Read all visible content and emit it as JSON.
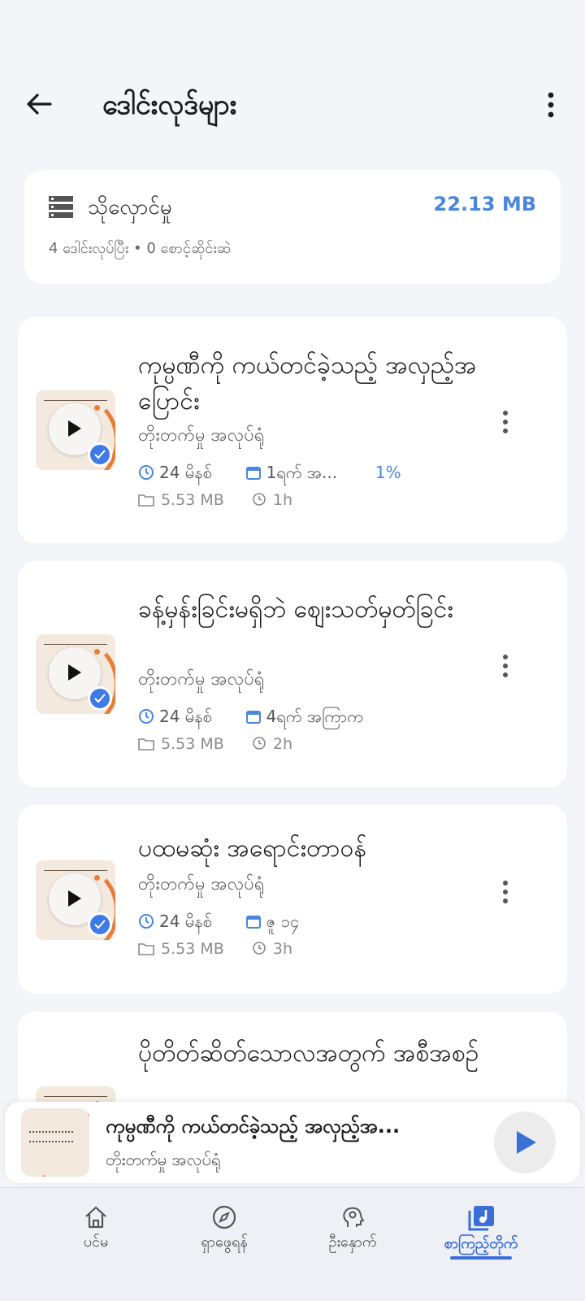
{
  "header": {
    "title": "ဒေါင်းလုဒ်များ"
  },
  "storage": {
    "title": "သိုလှောင်မှု",
    "size": "22.13 MB",
    "subtitle": "4 ဒေါင်းလုပ်ပြီး • 0 စောင့်ဆိုင်းဆဲ"
  },
  "episodes": [
    {
      "title": "ကုမ္ပဏီကို ကယ်တင်ခဲ့သည့် အလှည့်အပြောင်း",
      "author": "တိုးတက်မှု အလုပ်ရုံ",
      "duration": "24 မိနစ်",
      "date": "1ရက် အ...",
      "progress": "1%",
      "file_size": "5.53 MB",
      "age": "1h"
    },
    {
      "title": "ခန့်မှန်းခြင်းမရှိဘဲ စျေးသတ်မှတ်ခြင်း",
      "author": "တိုးတက်မှု အလုပ်ရုံ",
      "duration": "24 မိနစ်",
      "date": "4ရက် အကြာက",
      "file_size": "5.53 MB",
      "age": "2h"
    },
    {
      "title": "ပထမဆုံး အရောင်းတာဝန်",
      "author": "တိုးတက်မှု အလုပ်ရုံ",
      "duration": "24 မိနစ်",
      "date": "ဇူ ၁၄",
      "file_size": "5.53 MB",
      "age": "3h"
    },
    {
      "title": "ပိုတိတ်ဆိတ်သောလအတွက် အစီအစဉ်"
    }
  ],
  "mini_player": {
    "title": "ကုမ္ပဏီကို ကယ်တင်ခဲ့သည့် အလှည့်အ...",
    "author": "တိုးတက်မှု အလုပ်ရုံ"
  },
  "nav": {
    "home": "ပင်မ",
    "explore": "ရှာဖွေရန်",
    "mindset": "ဦးနှောက်",
    "library": "စာကြည့်တိုက်"
  },
  "colors": {
    "accent": "#4a86e0",
    "thumb_orange": "#e87d3a",
    "badge_blue": "#3f7be6"
  }
}
